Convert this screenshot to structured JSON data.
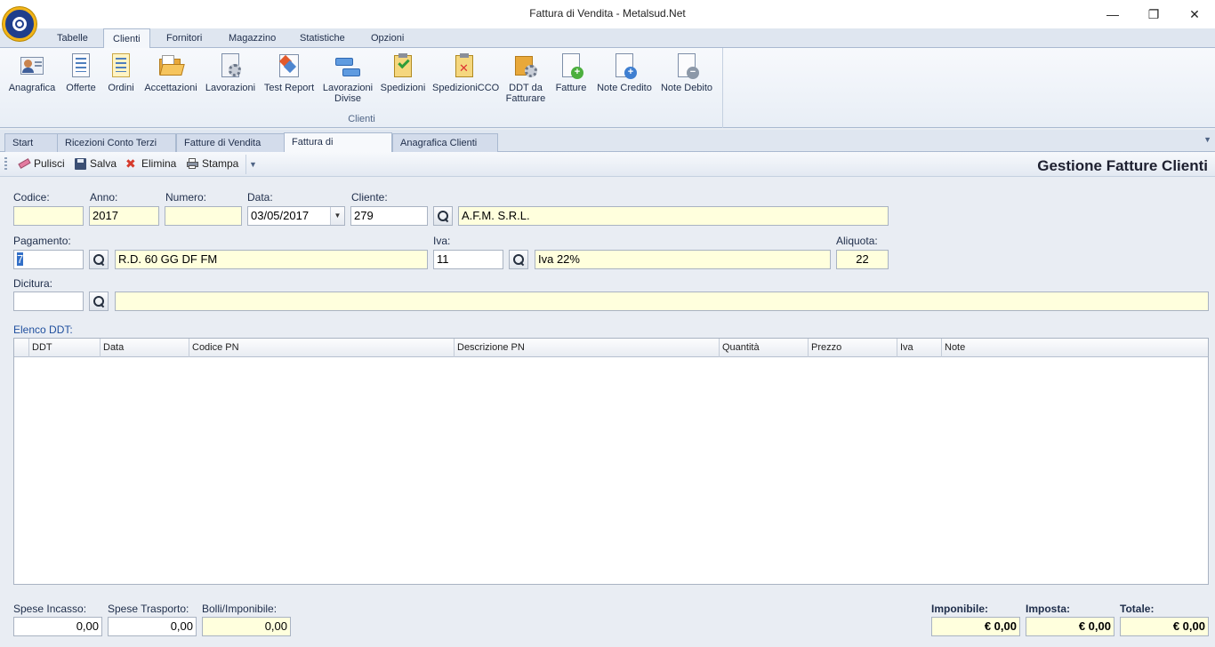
{
  "window": {
    "title": "Fattura di Vendita - Metalsud.Net",
    "minimize": "—",
    "maximize": "❐",
    "close": "✕"
  },
  "ribbon_tabs": [
    "Tabelle",
    "Clienti",
    "Fornitori",
    "Magazzino",
    "Statistiche",
    "Opzioni"
  ],
  "ribbon": {
    "group_label": "Clienti",
    "buttons": {
      "anagrafica": "Anagrafica",
      "offerte": "Offerte",
      "ordini": "Ordini",
      "accettazioni": "Accettazioni",
      "lavorazioni": "Lavorazioni",
      "test_report": "Test Report",
      "lavorazioni_divise_1": "Lavorazioni",
      "lavorazioni_divise_2": "Divise",
      "spedizioni": "Spedizioni",
      "spedizioni_cco": "SpedizioniCCO",
      "ddt_1": "DDT da",
      "ddt_2": "Fatturare",
      "fatture": "Fatture",
      "note_credito": "Note Credito",
      "note_debito": "Note Debito"
    }
  },
  "doc_tabs": [
    "Start",
    "Ricezioni Conto Terzi",
    "Fatture di Vendita",
    "Fattura di Vendita",
    "Anagrafica Clienti"
  ],
  "doc_tab_close": "✕",
  "toolbar": {
    "pulisci": "Pulisci",
    "salva": "Salva",
    "elimina": "Elimina",
    "stampa": "Stampa",
    "heading": "Gestione Fatture Clienti"
  },
  "form": {
    "codice_label": "Codice:",
    "codice": "",
    "anno_label": "Anno:",
    "anno": "2017",
    "numero_label": "Numero:",
    "numero": "",
    "data_label": "Data:",
    "data": "03/05/2017",
    "cliente_label": "Cliente:",
    "cliente_code": "279",
    "cliente_name": "A.F.M.  S.R.L.",
    "pagamento_label": "Pagamento:",
    "pagamento_code": "7",
    "pagamento_desc": "R.D.  60 GG DF FM",
    "iva_label": "Iva:",
    "iva_code": "11",
    "iva_desc": "Iva 22%",
    "aliquota_label": "Aliquota:",
    "aliquota": "22",
    "dicitura_label": "Dicitura:",
    "dicitura_code": "",
    "dicitura_text": ""
  },
  "grid": {
    "title": "Elenco DDT:",
    "columns": [
      "DDT",
      "Data",
      "Codice PN",
      "Descrizione PN",
      "Quantità",
      "Prezzo",
      "Iva",
      "Note"
    ],
    "rows": []
  },
  "totals": {
    "spese_incasso_label": "Spese Incasso:",
    "spese_incasso": "0,00",
    "spese_trasporto_label": "Spese  Trasporto:",
    "spese_trasporto": "0,00",
    "bolli_label": "Bolli/Imponibile:",
    "bolli": "0,00",
    "imponibile_label": "Imponibile:",
    "imponibile": "€ 0,00",
    "imposta_label": "Imposta:",
    "imposta": "€ 0,00",
    "totale_label": "Totale:",
    "totale": "€ 0,00"
  },
  "colors": {
    "accent": "#3370c8",
    "readonly_bg": "#ffffdd",
    "ribbon_bg": "#e8eef6"
  }
}
